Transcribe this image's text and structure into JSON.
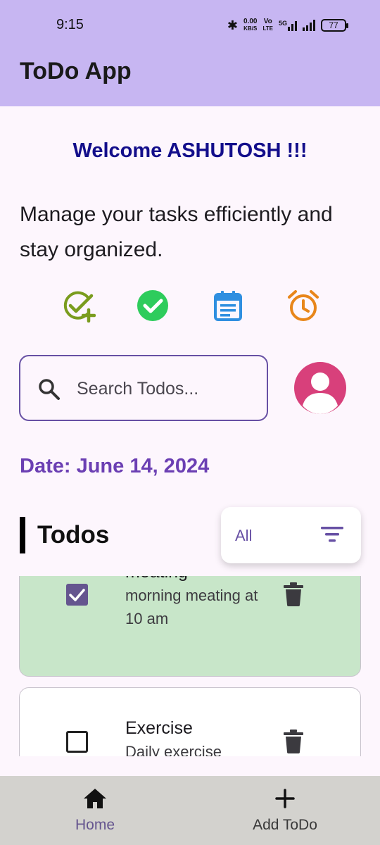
{
  "status_bar": {
    "time": "9:15",
    "net_speed": "0.00",
    "net_unit": "KB/S",
    "volte_top": "Vo",
    "volte_bottom": "LTE",
    "signal_label": "5G",
    "battery": "77"
  },
  "app": {
    "title": "ToDo App"
  },
  "welcome": "Welcome ASHUTOSH !!!",
  "tagline": "Manage your tasks efficiently and stay organized.",
  "feature_icons": [
    "check-add-icon",
    "check-circle-icon",
    "calendar-icon",
    "alarm-icon"
  ],
  "search": {
    "placeholder": "Search Todos...",
    "value": ""
  },
  "date_label": "Date: June 14, 2024",
  "todos_heading": "Todos",
  "filter": {
    "selected": "All"
  },
  "todos": [
    {
      "title": "meating",
      "description": "morning meating at 10 am",
      "done": true
    },
    {
      "title": "Exercise",
      "description": "Daily exercise",
      "done": false
    }
  ],
  "bottom_nav": [
    {
      "label": "Home",
      "icon": "home-icon",
      "active": true
    },
    {
      "label": "Add ToDo",
      "icon": "add-icon",
      "active": false
    }
  ],
  "colors": {
    "appbar": "#c7b6f2",
    "accent": "#6750a4",
    "welcome": "#130e8b",
    "done_card": "#c8e6c9",
    "avatar": "#d8407b",
    "bottom_nav": "#d3d2ce"
  }
}
